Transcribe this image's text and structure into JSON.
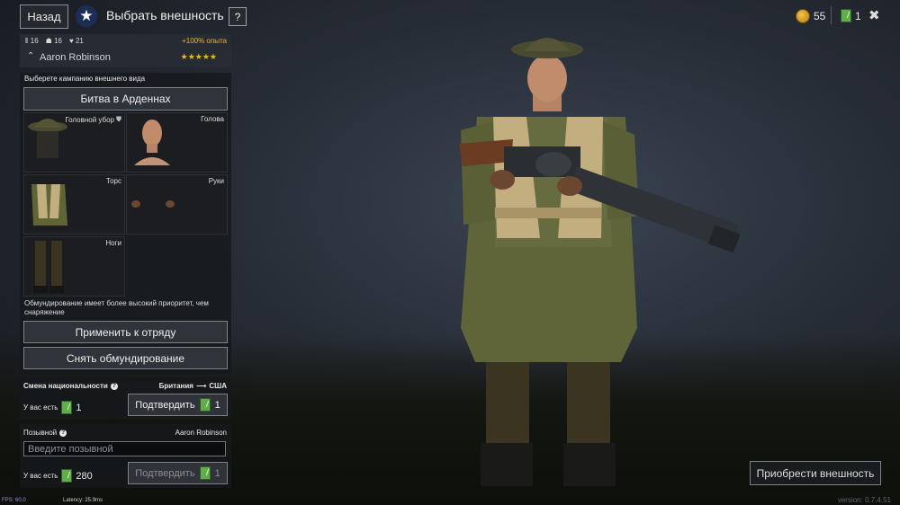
{
  "header": {
    "back_label": "Назад",
    "title": "Выбрать внешность",
    "help_label": "?",
    "gold": "55",
    "tickets": "1",
    "close_label": "✖"
  },
  "soldier": {
    "stat1": "16",
    "stat2": "16",
    "stat3": "21",
    "exp_bonus": "+100% опыта",
    "name": "Aaron Robinson",
    "rank_icon": "chevron-up-icon",
    "stars": "★★★★★"
  },
  "appearance": {
    "campaign_prompt": "Выберете кампанию внешнего вида",
    "campaign": "Битва в Арденнах",
    "slots": [
      {
        "label": "Головной убор"
      },
      {
        "label": "Голова"
      },
      {
        "label": "Торс"
      },
      {
        "label": "Руки"
      },
      {
        "label": "Ноги"
      }
    ],
    "note": "Обмундирование имеет более высокий приоритет, чем снаряжение",
    "apply_label": "Применить к отряду",
    "remove_label": "Снять обмундирование"
  },
  "nationality": {
    "title": "Смена национальности",
    "from": "Британия",
    "to": "США",
    "have_label": "У вас есть",
    "have_count": "1",
    "confirm_label": "Подтвердить",
    "cost": "1"
  },
  "callsign": {
    "title": "Позывной",
    "current": "Aaron Robinson",
    "placeholder": "Введите позывной",
    "have_label": "У вас есть",
    "have_count": "280",
    "confirm_label": "Подтвердить",
    "cost": "1"
  },
  "buy_label": "Приобрести внешность",
  "debug": {
    "fps": "FPS: 60.0",
    "latency": "Latency: 25.9ms",
    "version": "version: 0.7.4.51"
  },
  "colors": {
    "accent_gold": "#f0b429",
    "ticket_green": "#5fae4b",
    "badge_blue": "#1d2d57"
  }
}
